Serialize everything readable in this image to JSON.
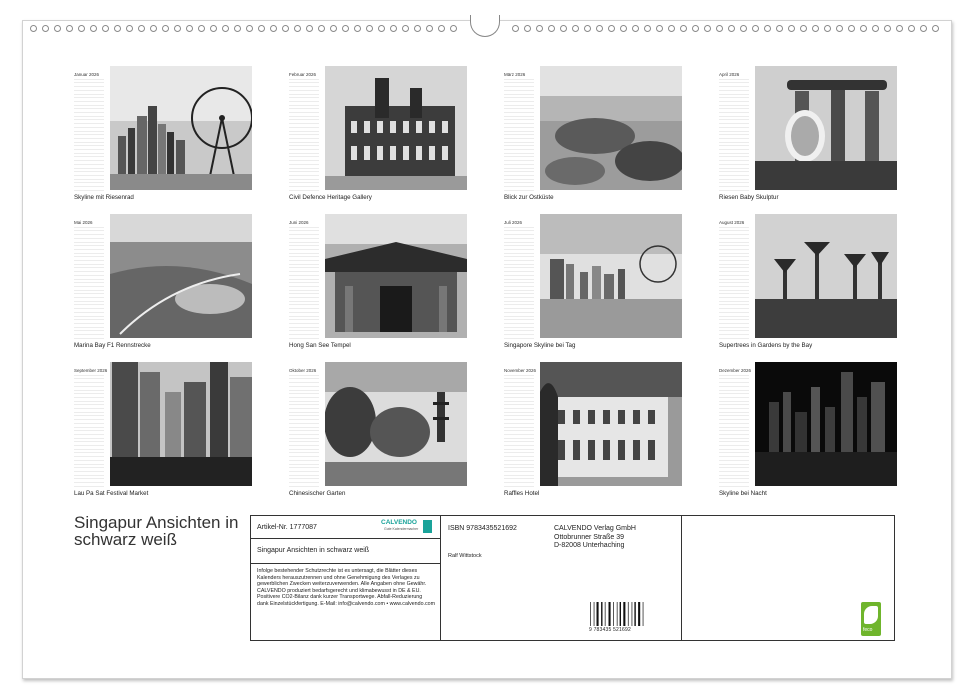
{
  "months": [
    {
      "name": "Januar 2026",
      "caption": "Skyline mit Riesenrad",
      "scene": "wheel-skyline"
    },
    {
      "name": "Februar 2026",
      "caption": "Civil Defence Heritage Gallery",
      "scene": "building"
    },
    {
      "name": "März 2026",
      "caption": "Blick zur Ostküste",
      "scene": "aerial-park"
    },
    {
      "name": "April 2026",
      "caption": "Riesen Baby Skulptur",
      "scene": "mbs-sculpture"
    },
    {
      "name": "Mai 2026",
      "caption": "Marina Bay F1 Rennstrecke",
      "scene": "aerial-bay"
    },
    {
      "name": "Juni 2026",
      "caption": "Hong San See Tempel",
      "scene": "temple"
    },
    {
      "name": "Juli 2026",
      "caption": "Singapore Skyline bei Tag",
      "scene": "skyline-water"
    },
    {
      "name": "August 2026",
      "caption": "Supertrees in Gardens by the Bay",
      "scene": "supertrees"
    },
    {
      "name": "September 2026",
      "caption": "Lau Pa Sat Festival Market",
      "scene": "towers"
    },
    {
      "name": "Oktober 2026",
      "caption": "Chinesischer Garten",
      "scene": "garden"
    },
    {
      "name": "November 2026",
      "caption": "Raffles Hotel",
      "scene": "hotel"
    },
    {
      "name": "Dezember 2026",
      "caption": "Skyline bei Nacht",
      "scene": "night"
    }
  ],
  "cover_title": "Singapur Ansichten in schwarz weiß",
  "info": {
    "article": "Artikel-Nr. 1777087",
    "brand": "CALVENDO",
    "brand_sub": "Gute Kalendermacher",
    "title": "Singapur Ansichten in schwarz weiß",
    "legal": "Infolge bestehender Schutzrechte ist es untersagt, die Blätter dieses Kalenders herauszutrennen und ohne Genehmigung des Verlages zu gewerblichen Zwecken weiterzuverwenden. Alle Angaben ohne Gewähr. CALVENDO produziert bedarfsgerecht und klimabewusst in DE & EU. Positivere CO2-Bilanz dank kurzer Transportwege. Abfall-Reduzierung dank Einzelstückfertigung. E-Mail: info@calvendo.com • www.calvendo.com",
    "isbn": "ISBN 9783435521692",
    "author": "Ralf Wittstock",
    "publisher_name": "CALVENDO Verlag GmbH",
    "publisher_street": "Ottobrunner Straße 39",
    "publisher_city": "D-82008 Unterhaching",
    "barcode_number": "9 783435 521692",
    "eco_label": "feco"
  },
  "colors": {
    "eco_green": "#6fb52c",
    "brand_teal": "#1aa39a"
  }
}
